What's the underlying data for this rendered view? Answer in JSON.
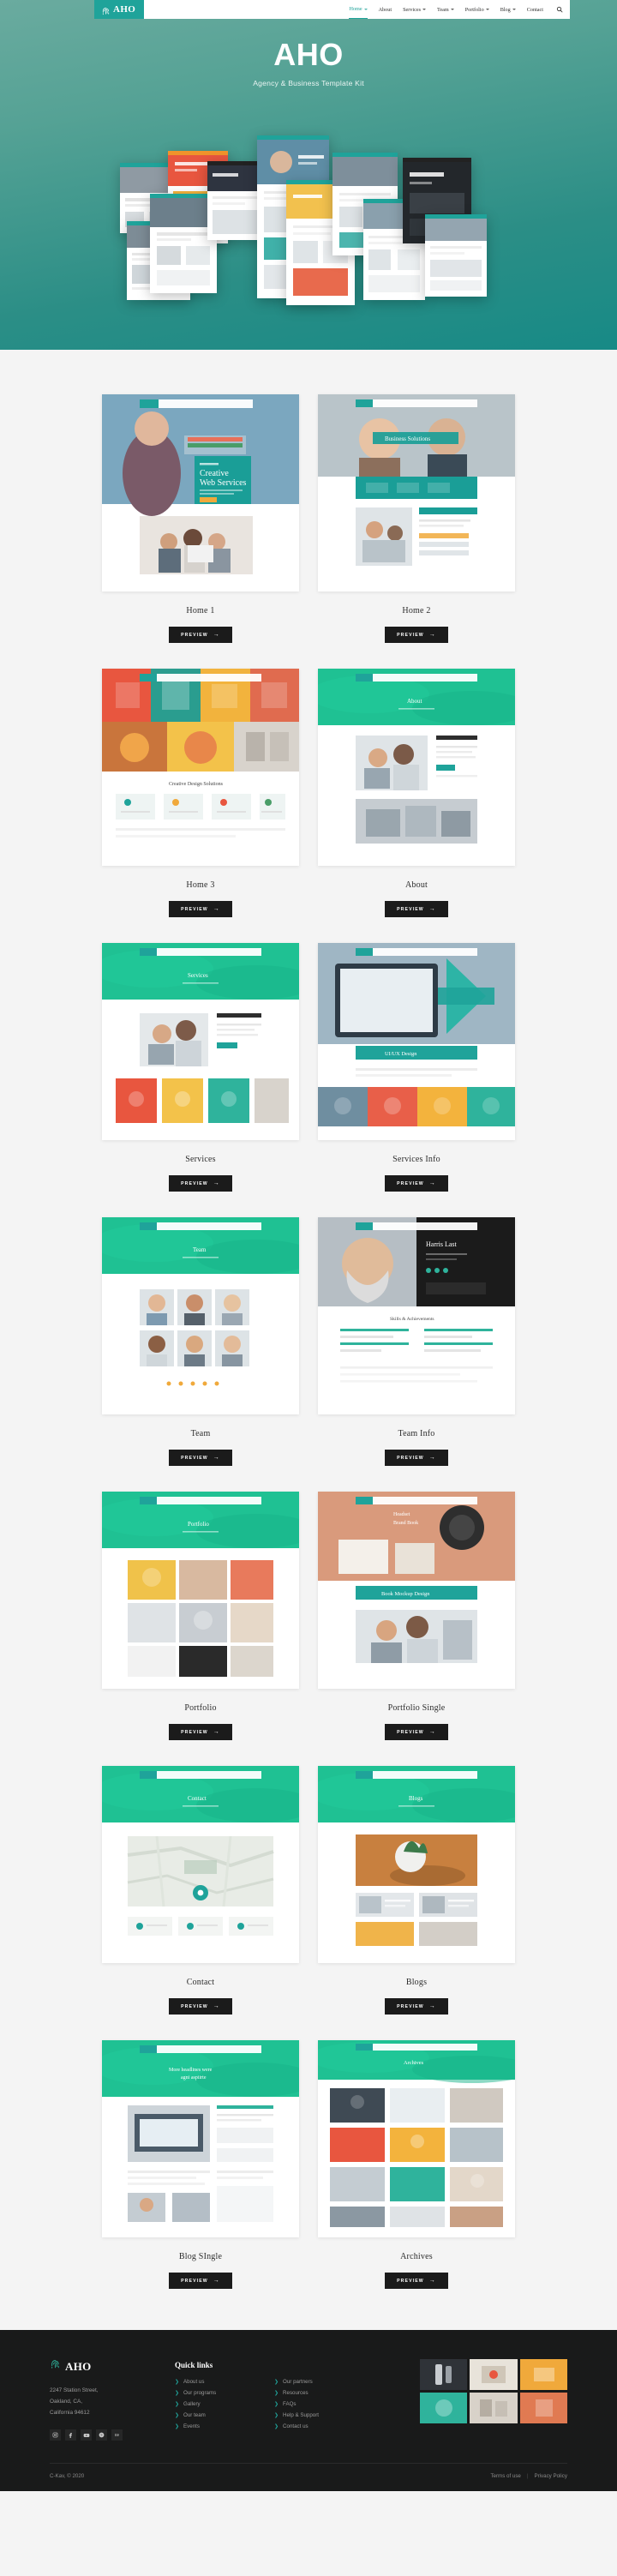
{
  "nav": {
    "brand": "AHO",
    "brand_icon": "fingerprint-icon",
    "items": [
      {
        "label": "Home",
        "caret": true,
        "active": true
      },
      {
        "label": "About",
        "caret": false,
        "active": false
      },
      {
        "label": "Services",
        "caret": true,
        "active": false
      },
      {
        "label": "Team",
        "caret": true,
        "active": false
      },
      {
        "label": "Portfolio",
        "caret": true,
        "active": false
      },
      {
        "label": "Blog",
        "caret": true,
        "active": false
      },
      {
        "label": "Contact",
        "caret": false,
        "active": false
      }
    ],
    "search_icon": "search-icon"
  },
  "hero": {
    "title": "AHO",
    "subtitle": "Agency & Business Template Kit"
  },
  "demos": {
    "preview_label": "PREVIEW",
    "preview_arrow": "→",
    "rows": [
      [
        {
          "title": "Home 1",
          "kind": "home1"
        },
        {
          "title": "Home 2",
          "kind": "home2"
        }
      ],
      [
        {
          "title": "Home 3",
          "kind": "home3"
        },
        {
          "title": "About",
          "kind": "about"
        }
      ],
      [
        {
          "title": "Services",
          "kind": "services"
        },
        {
          "title": "Services Info",
          "kind": "servicesinfo"
        }
      ],
      [
        {
          "title": "Team",
          "kind": "team"
        },
        {
          "title": "Team Info",
          "kind": "teaminfo"
        }
      ],
      [
        {
          "title": "Portfolio",
          "kind": "portfolio"
        },
        {
          "title": "Portfolio Single",
          "kind": "portfoliosingle"
        }
      ],
      [
        {
          "title": "Contact",
          "kind": "contact"
        },
        {
          "title": "Blogs",
          "kind": "blogs"
        }
      ],
      [
        {
          "title": "Blog SIngle",
          "kind": "blogsingle"
        },
        {
          "title": "Archives",
          "kind": "archives"
        }
      ]
    ]
  },
  "footer": {
    "brand": "AHO",
    "address_lines": [
      "2247  Station Street,",
      "Oakland, CA,",
      "California 94612"
    ],
    "socials": [
      "instagram-icon",
      "facebook-icon",
      "youtube-icon",
      "skype-icon",
      "behance-icon"
    ],
    "links_heading": "Quick links",
    "links_col1": [
      "About us",
      "Our programs",
      "Gallery",
      "Our team",
      "Events"
    ],
    "links_col2": [
      "Our partners",
      "Resources",
      "FAQs",
      "Help & Support",
      "Contact us"
    ],
    "bullet": "❯",
    "copyright": "C-Kav, © 2020",
    "terms": "Terms of use",
    "privacy": "Privacy Policy",
    "separator": "|"
  },
  "colors": {
    "accent": "#1fa39a",
    "hero_top": "#6aab9f",
    "hero_bottom": "#178a86",
    "page_bg": "#f4f4f4",
    "footer_bg": "#191a1a",
    "button_bg": "#1b1b1b"
  }
}
